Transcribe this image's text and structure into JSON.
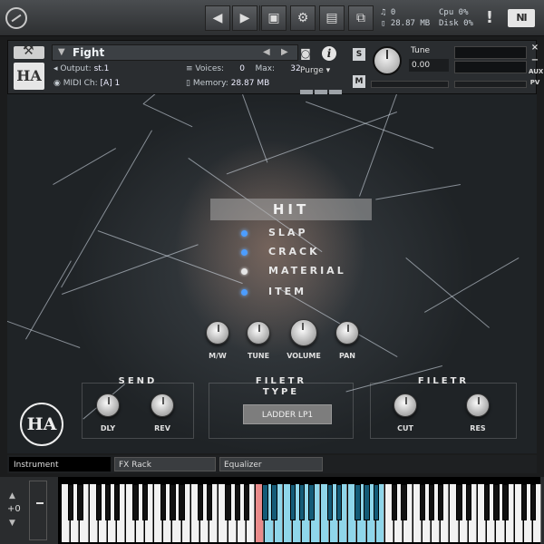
{
  "toolbar": {
    "prev_icon": "chevron-left-icon",
    "next_icon": "chevron-right-icon",
    "save_icon": "save-icon",
    "settings_icon": "gear-icon",
    "view_icon": "layout-icon",
    "resize_icon": "resize-icon",
    "stats": {
      "voices_line": "♫ 0",
      "memory_line": "▯ 28.87 MB",
      "cpu_line": "Cpu  0%",
      "disk_line": "Disk  0%"
    },
    "warn_label": "!",
    "ni_logo": "NI"
  },
  "instrument": {
    "name": "Fight",
    "output_label": "Output:",
    "output_value": "st.1",
    "voices_label": "Voices:",
    "voices_value": "0",
    "max_label": "Max:",
    "max_value": "32",
    "purge_label": "Purge",
    "midi_label": "MIDI Ch:",
    "midi_value": "[A] 1",
    "memory_label": "Memory:",
    "memory_value": "28.87 MB",
    "solo_label": "S",
    "mute_label": "M",
    "tune_label": "Tune",
    "tune_value": "0.00",
    "aux_label": "AUX",
    "pv_label": "PV",
    "close_label": "×",
    "min_label": "−",
    "logo_text": "HA"
  },
  "panel": {
    "title": "HIT",
    "menu_items": [
      {
        "label": "SLAP",
        "selected": false
      },
      {
        "label": "CRACK",
        "selected": false
      },
      {
        "label": "MATERIAL",
        "selected": true
      },
      {
        "label": "ITEM",
        "selected": false
      }
    ],
    "knobs": [
      {
        "label": "M/W"
      },
      {
        "label": "TUNE"
      },
      {
        "label": "VOLUME"
      },
      {
        "label": "PAN"
      }
    ],
    "send": {
      "title": "SEND",
      "knobs": [
        {
          "label": "DLY"
        },
        {
          "label": "REV"
        }
      ]
    },
    "filter_type": {
      "title_line1": "FILETR",
      "title_line2": "TYPE",
      "value": "LADDER LP1"
    },
    "filter": {
      "title": "FILETR",
      "knobs": [
        {
          "label": "CUT"
        },
        {
          "label": "RES"
        }
      ]
    },
    "logo_text": "HA"
  },
  "tabs": [
    {
      "label": "Instrument",
      "active": true
    },
    {
      "label": "FX Rack",
      "active": false
    },
    {
      "label": "Equalizer",
      "active": false
    }
  ],
  "keyboard": {
    "octave_label": "+0",
    "up_icon": "▲",
    "down_icon": "▼"
  }
}
